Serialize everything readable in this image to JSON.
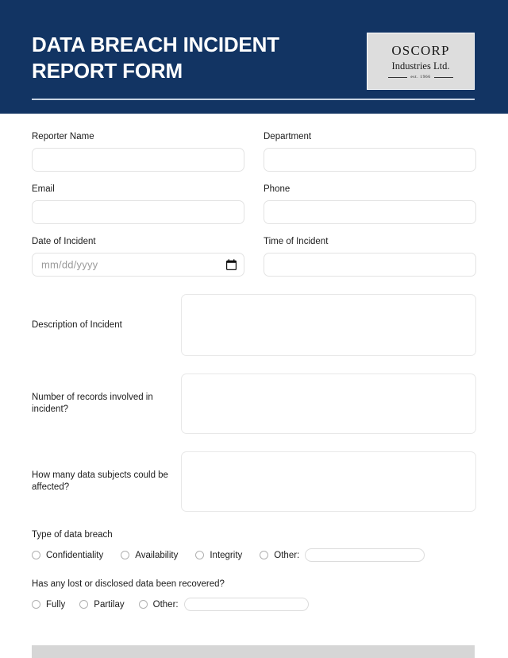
{
  "header": {
    "title": "DATA BREACH INCIDENT\nREPORT FORM",
    "background_color": "#123463",
    "rule_color": "#c7d3e2",
    "logo": {
      "name": "OSCORP",
      "subtitle": "Industries Ltd.",
      "established": "est. 1966"
    }
  },
  "form": {
    "fields": {
      "reporter_name": {
        "label": "Reporter Name",
        "value": "",
        "placeholder": ""
      },
      "department": {
        "label": "Department",
        "value": "",
        "placeholder": ""
      },
      "email": {
        "label": "Email",
        "value": "",
        "placeholder": ""
      },
      "phone": {
        "label": "Phone",
        "value": "",
        "placeholder": ""
      },
      "date_of_incident": {
        "label": "Date of Incident",
        "value": "",
        "placeholder": "mm/dd/yyyy"
      },
      "time_of_incident": {
        "label": "Time of Incident",
        "value": "",
        "placeholder": ""
      }
    },
    "textareas": [
      {
        "label": "Description of Incident",
        "value": ""
      },
      {
        "label": "Number of records involved in incident?",
        "value": ""
      },
      {
        "label": "How many data subjects could be affected?",
        "value": ""
      }
    ],
    "breach_type": {
      "question": "Type of data breach",
      "options": [
        "Confidentiality",
        "Availability",
        "Integrity"
      ],
      "other_label": "Other:",
      "other_value": ""
    },
    "recovery": {
      "question": "Has any lost or disclosed data been recovered?",
      "options": [
        "Fully",
        "Partilay"
      ],
      "other_label": "Other:",
      "other_value": ""
    }
  },
  "footer": {
    "bar_color": "#d6d6d6"
  }
}
